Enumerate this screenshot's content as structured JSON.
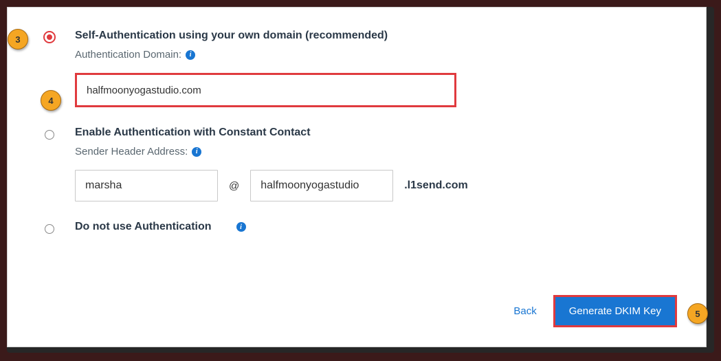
{
  "options": {
    "self": {
      "title": "Self-Authentication using your own domain (recommended)",
      "sub_label": "Authentication Domain:",
      "domain_value": "halfmoonyogastudio.com"
    },
    "cc": {
      "title": "Enable Authentication with Constant Contact",
      "sub_label": "Sender Header Address:",
      "user_value": "marsha",
      "at": "@",
      "sub_value": "halfmoonyogastudio",
      "suffix": ".l1send.com"
    },
    "none": {
      "title": "Do not use Authentication"
    }
  },
  "actions": {
    "back": "Back",
    "generate": "Generate DKIM Key"
  },
  "markers": {
    "m3": "3",
    "m4": "4",
    "m5": "5"
  },
  "icons": {
    "info_glyph": "i"
  }
}
